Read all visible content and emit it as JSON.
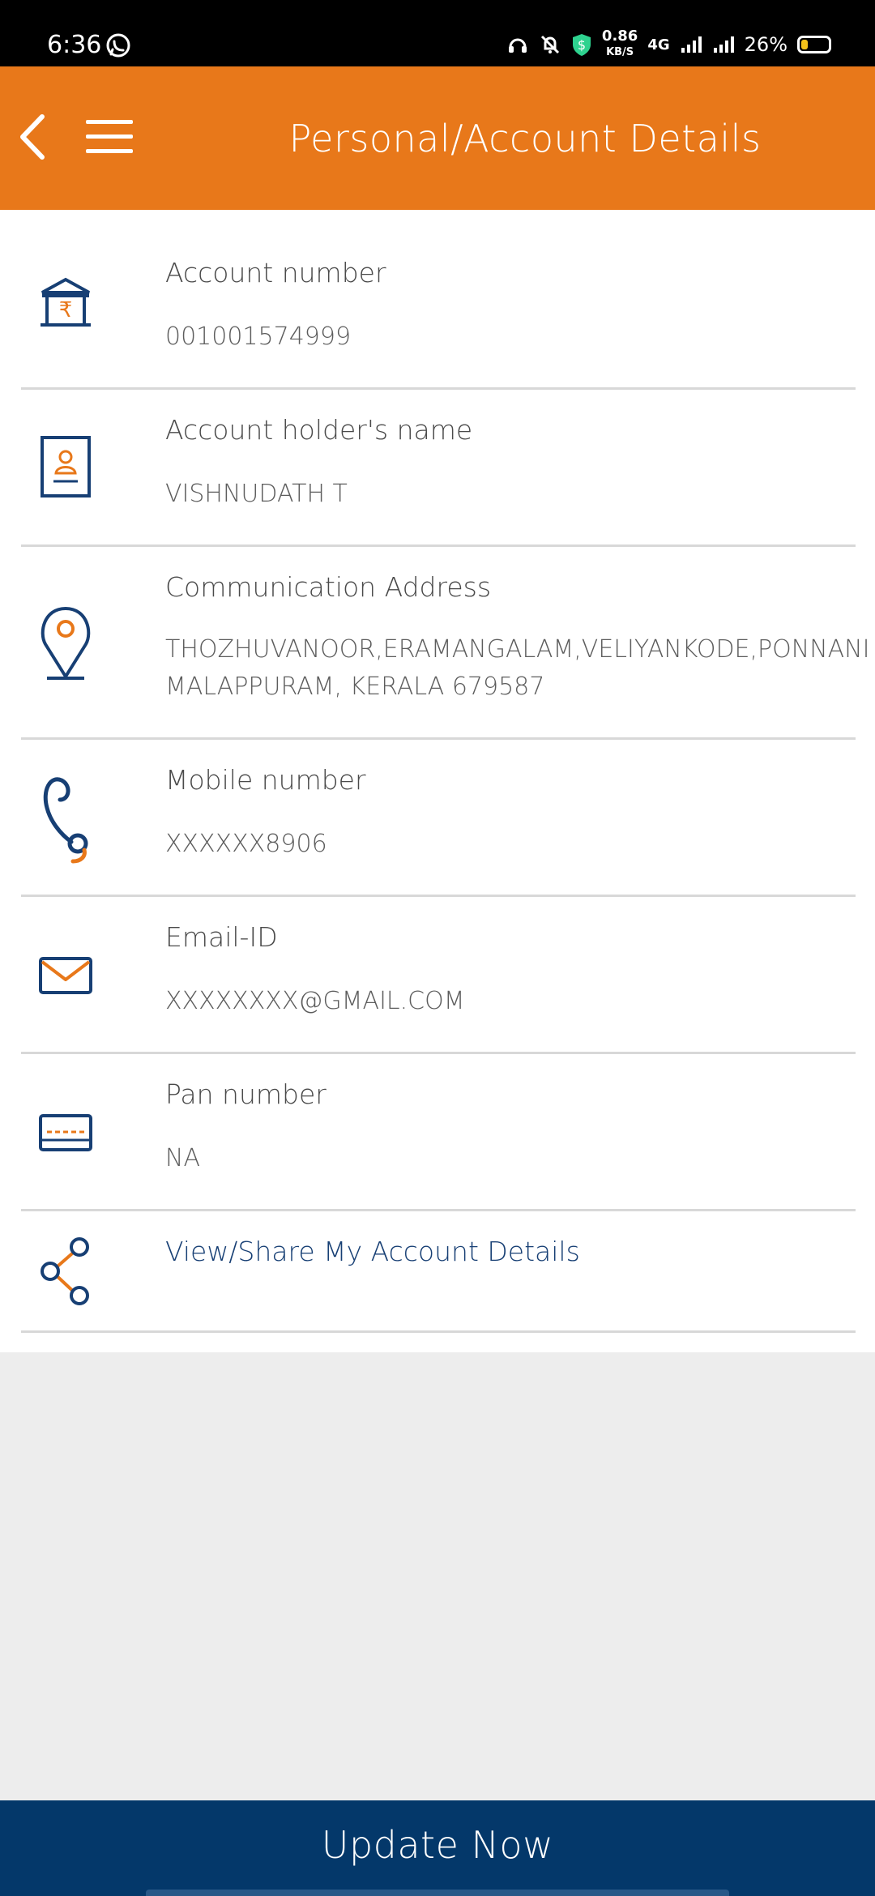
{
  "status_bar": {
    "time": "6:36",
    "network_speed_value": "0.86",
    "network_speed_unit": "KB/S",
    "network_type": "4G",
    "battery_percent": "26%",
    "battery_level": 0.26
  },
  "header": {
    "title": "Personal/Account Details"
  },
  "details": {
    "account_number": {
      "label": "Account number",
      "value": "001001574999"
    },
    "holder_name": {
      "label": "Account holder's name",
      "value": "VISHNUDATH T"
    },
    "address": {
      "label": "Communication Address",
      "line1": "THOZHUVANOOR,ERAMANGALAM,VELIYANKODE,PONNANI",
      "line2": "MALAPPURAM, KERALA 679587"
    },
    "mobile": {
      "label": "Mobile number",
      "value": "XXXXXX8906"
    },
    "email": {
      "label": "Email-ID",
      "value": "XXXXXXXX@GMAIL.COM"
    },
    "pan": {
      "label": "Pan number",
      "value": "NA"
    },
    "share": {
      "label": "View/Share My Account Details"
    }
  },
  "footer": {
    "button_label": "Update Now"
  },
  "colors": {
    "brand_orange": "#e8781a",
    "brand_navy": "#04386a",
    "icon_blue": "#173f74",
    "icon_orange": "#e8781a"
  },
  "icons": {
    "back": "chevron-left-icon",
    "menu": "hamburger-menu-icon",
    "account": "bank-rupee-icon",
    "holder": "id-card-icon",
    "address": "location-pin-icon",
    "mobile": "phone-icon",
    "email": "mail-envelope-icon",
    "pan": "card-icon",
    "share": "share-icon"
  }
}
